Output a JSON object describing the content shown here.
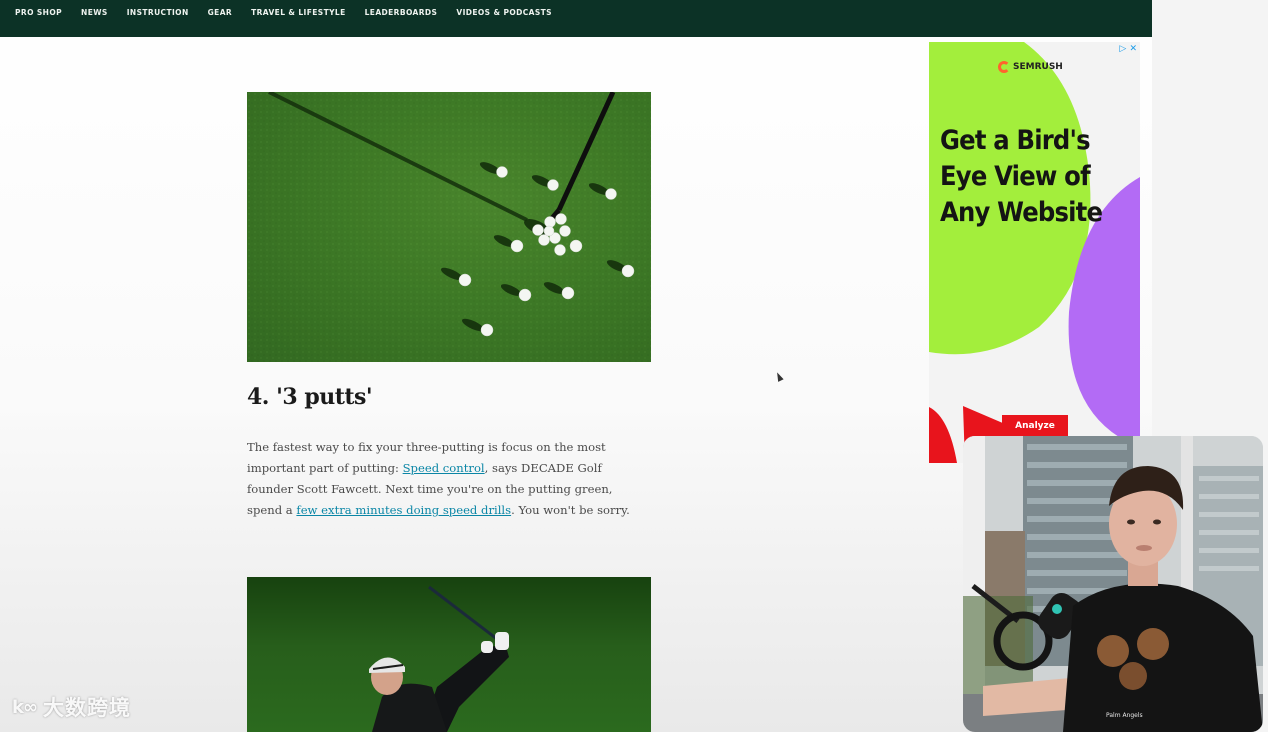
{
  "nav": {
    "items": [
      {
        "label": "PRO SHOP"
      },
      {
        "label": "NEWS"
      },
      {
        "label": "INSTRUCTION"
      },
      {
        "label": "GEAR"
      },
      {
        "label": "TRAVEL & LIFESTYLE"
      },
      {
        "label": "LEADERBOARDS"
      },
      {
        "label": "VIDEOS & PODCASTS"
      }
    ]
  },
  "article": {
    "heading": "4. '3 putts'",
    "body": {
      "part1": "The fastest way to fix your three-putting is focus on the most important part of putting: ",
      "link1": "Speed control",
      "part2": ", says DECADE Golf founder Scott Fawcett. Next time you're on the putting green, spend a ",
      "link2": "few extra minutes doing speed drills",
      "part3": ". You won't be sorry."
    }
  },
  "ad": {
    "brand": "SEMRUSH",
    "headline": "Get a Bird's Eye View of Any Website",
    "cta": "Analyze",
    "adchoices": "▷ ✕",
    "colors": {
      "green": "#a3ee3c",
      "purple": "#b36bf5",
      "red": "#e8141c"
    }
  },
  "webcam": {
    "shirt_text": "Palm Angels"
  },
  "watermark": {
    "mark": "k∞",
    "text": "大数跨境"
  },
  "colors": {
    "nav_bg": "#0c3226",
    "link": "#0a86a6"
  }
}
